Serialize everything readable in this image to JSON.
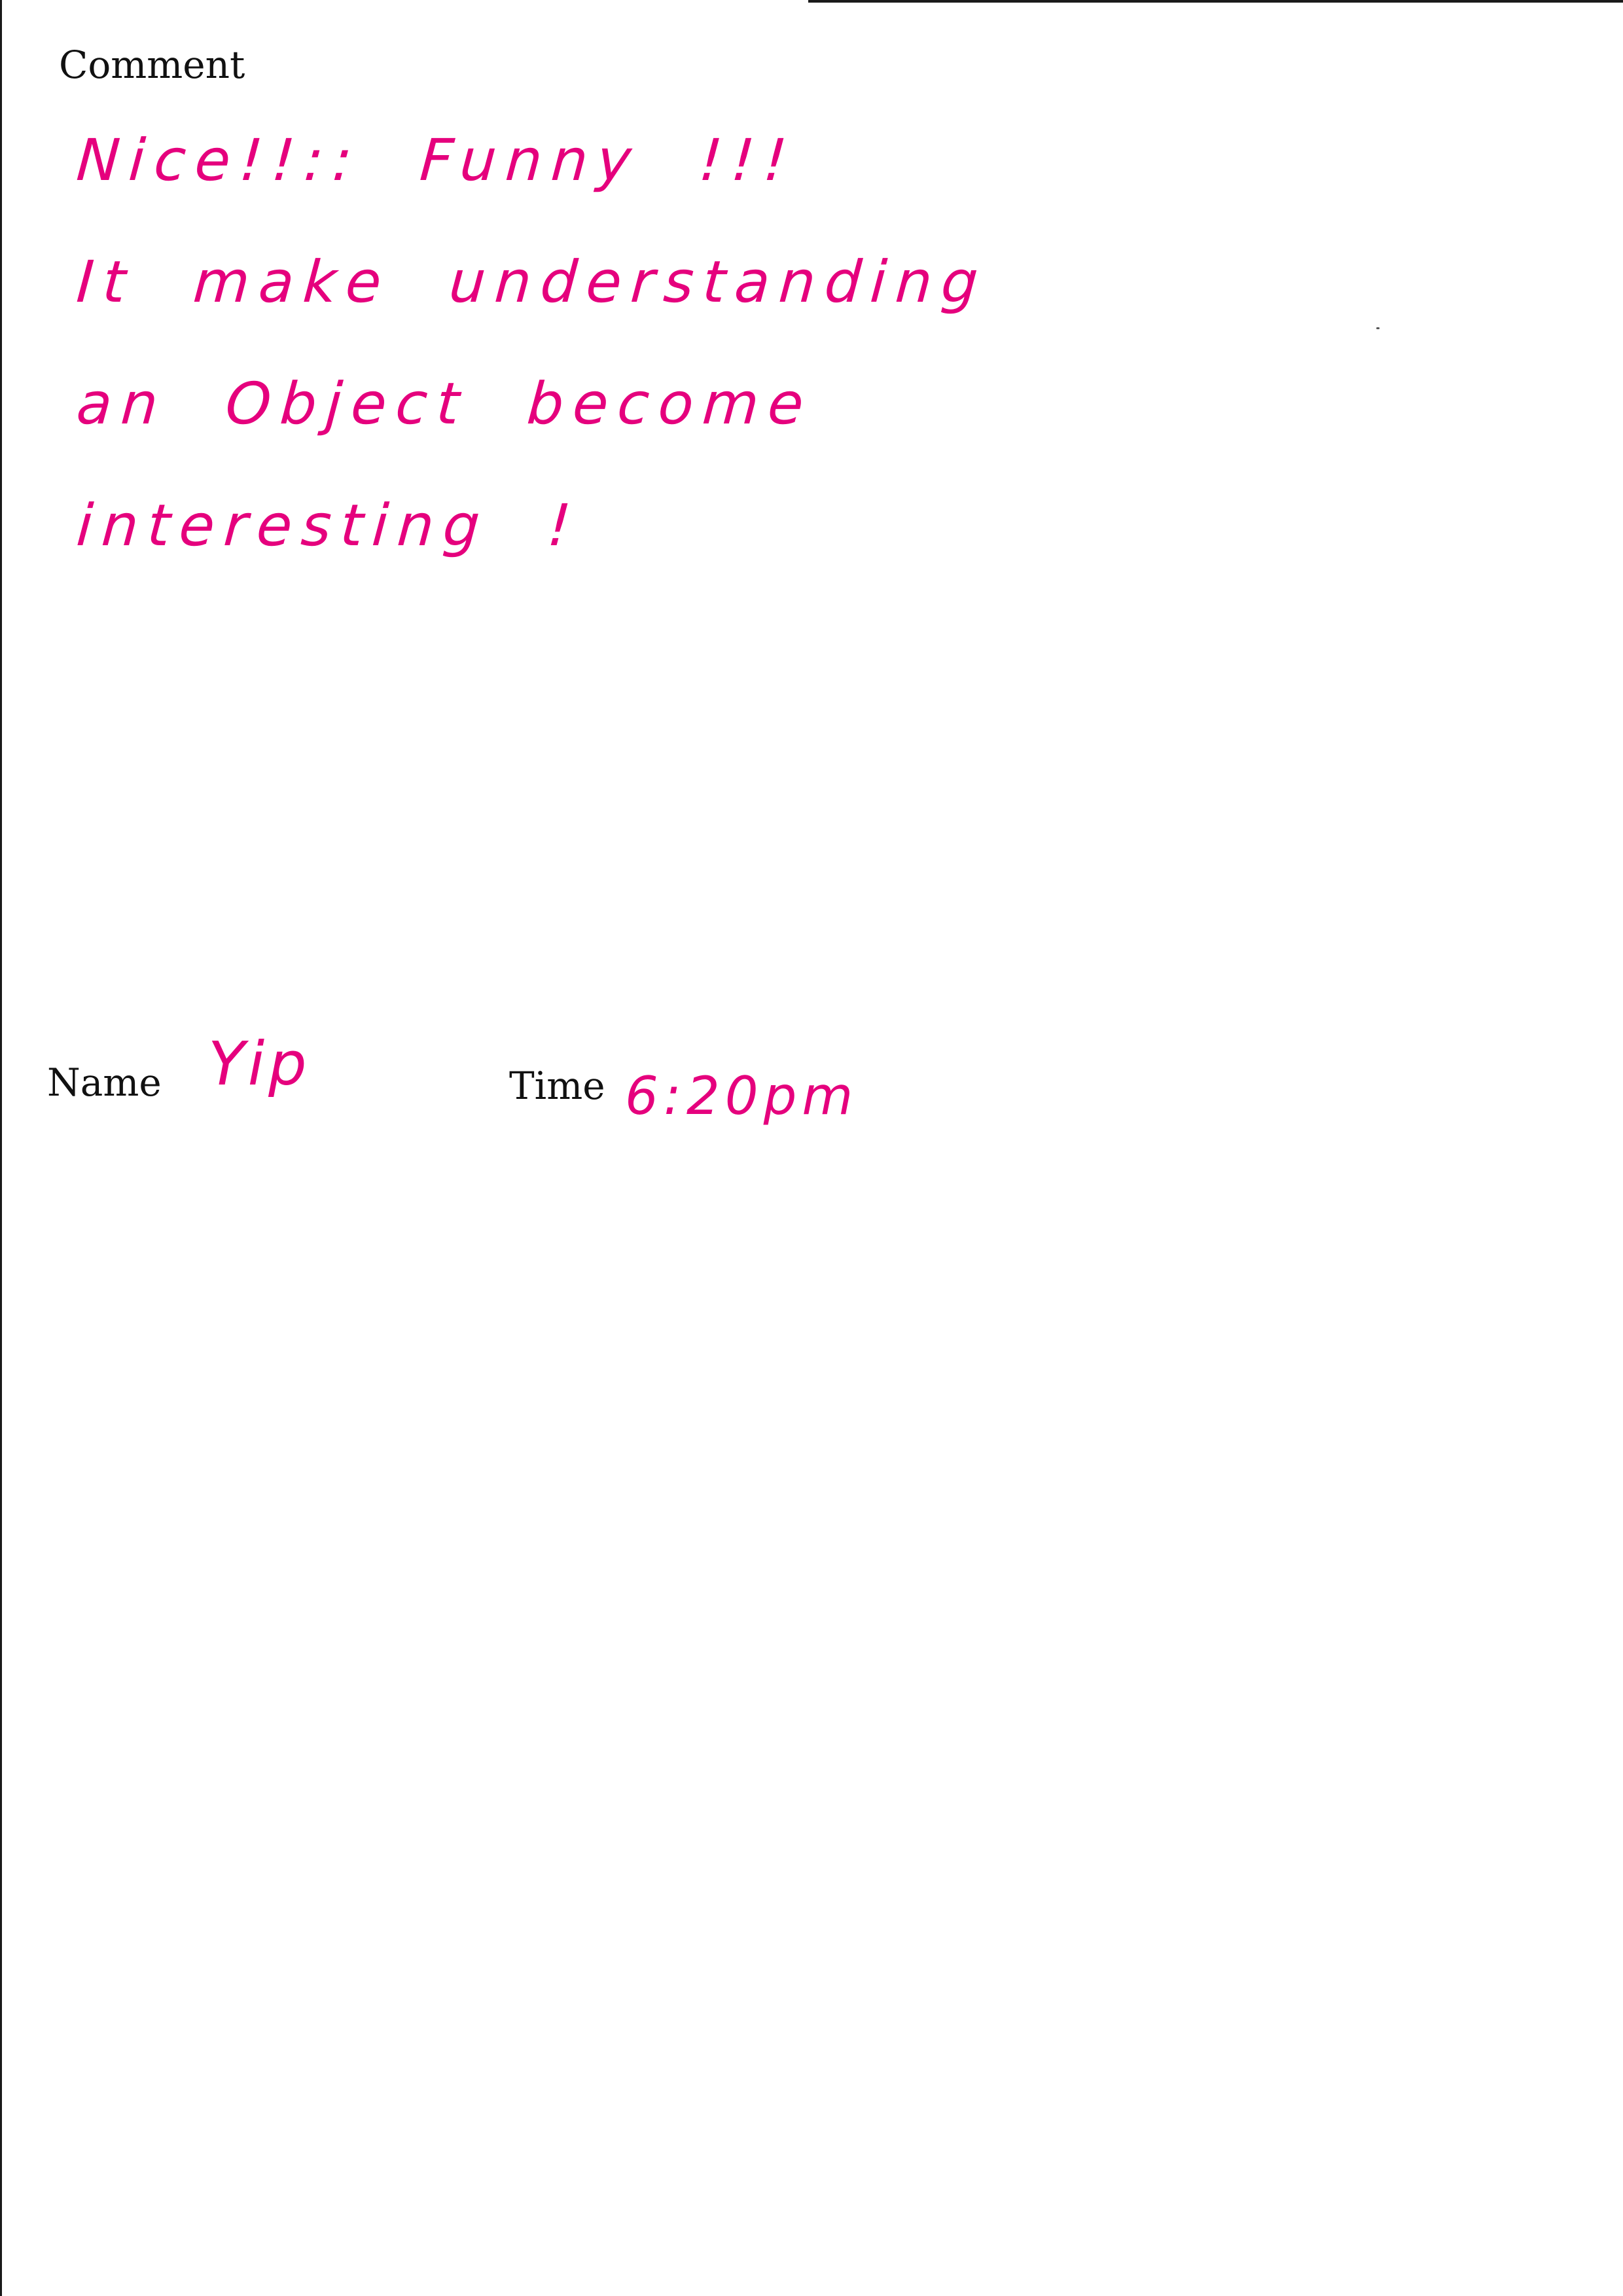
{
  "form": {
    "comment_label": "Comment",
    "name_label": "Name",
    "time_label": "Time"
  },
  "handwritten": {
    "comment_lines": [
      "Nice!!:: Funny !!!",
      "It make understanding",
      "an Object become",
      "interesting !"
    ],
    "name": "Yip",
    "time": "6:20pm"
  },
  "colors": {
    "ink": "#e5007d",
    "print": "#111111",
    "paper": "#ffffff"
  }
}
